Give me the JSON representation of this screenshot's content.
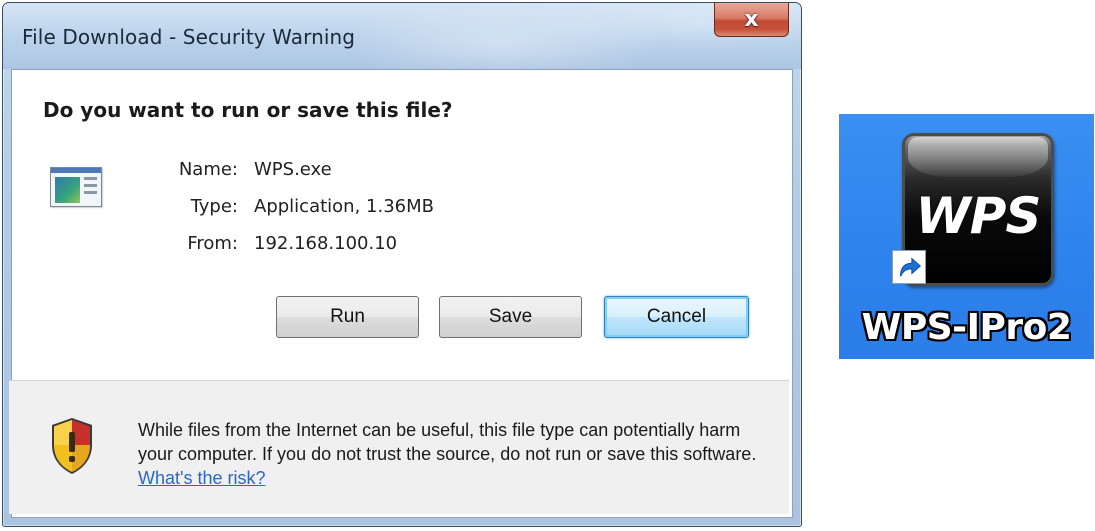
{
  "dialog": {
    "title": "File Download - Security Warning",
    "close_label": "x",
    "question": "Do you want to run or save this file?",
    "file": {
      "name_label": "Name:",
      "name_value": "WPS.exe",
      "type_label": "Type:",
      "type_value": "Application, 1.36MB",
      "from_label": "From:",
      "from_value": "192.168.100.10"
    },
    "buttons": {
      "run": "Run",
      "save": "Save",
      "cancel": "Cancel",
      "default": "cancel"
    },
    "warning": {
      "text": "While files from the Internet can be useful, this file type can potentially harm your computer. If you do not trust the source, do not run or save this software.",
      "link": "What's the risk?"
    }
  },
  "desktop_shortcut": {
    "tile_text": "WPS",
    "label": "WPS-IPro2",
    "icon": "wps-app-icon",
    "overlay_icon": "shortcut-arrow-icon"
  },
  "colors": {
    "desktop_selection": "#2e82ec",
    "link": "#2a66c9",
    "close_button": "#c7523a",
    "shield_yellow": "#f2c01e",
    "shield_red": "#c8312a"
  }
}
